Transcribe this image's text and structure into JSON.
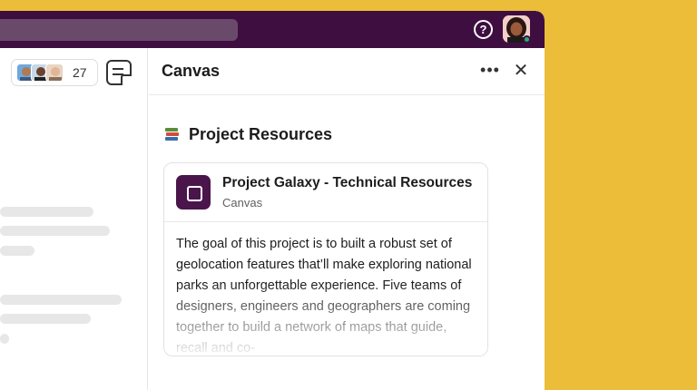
{
  "members": {
    "count": "27"
  },
  "canvas_panel": {
    "title": "Canvas",
    "section_heading": "Project Resources",
    "card": {
      "title": "Project Galaxy - Technical Resources",
      "subtitle": "Canvas",
      "body": "The goal of this project is to built a robust set of geolocation features that’ll make exploring national parks an unforgettable experience. Five teams of designers, engineers and geographers are coming together to build a network of maps that guide, recall and co-"
    }
  },
  "icons": {
    "help": "help-icon",
    "more": "more-options-icon",
    "close": "close-icon",
    "canvas": "canvas-icon",
    "books": "books-emoji"
  },
  "colors": {
    "background": "#ebbd38",
    "topbar": "#3f0e40",
    "card_icon": "#4a154b"
  }
}
